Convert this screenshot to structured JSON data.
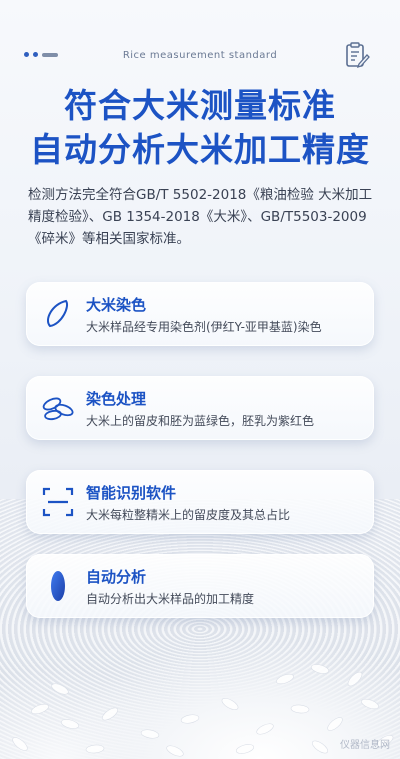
{
  "header": {
    "subtitle": "Rice measurement standard",
    "doc_icon": "document-edit-icon"
  },
  "headline": {
    "line1": "符合大米测量标准",
    "line2": "自动分析大米加工精度"
  },
  "description": "检测方法完全符合GB/T 5502-2018《粮油检验 大米加工精度检验》、GB 1354-2018《大米》、GB/T5503-2009《碎米》等相关国家标准。",
  "features": [
    {
      "icon": "rice-grain-icon",
      "title": "大米染色",
      "text": "大米样品经专用染色剂(伊红Y-亚甲基蓝)染色"
    },
    {
      "icon": "stained-grains-icon",
      "title": "染色处理",
      "text": "大米上的留皮和胚为蓝绿色，胚乳为紫红色"
    },
    {
      "icon": "scan-recognition-icon",
      "title": "智能识别软件",
      "text": "大米每粒整精米上的留皮度及其总占比"
    },
    {
      "icon": "blue-grain-icon",
      "title": "自动分析",
      "text": "自动分析出大米样品的加工精度"
    }
  ],
  "watermark": "仪器信息网",
  "colors": {
    "accent": "#1c53c4",
    "text": "#3a4254"
  }
}
